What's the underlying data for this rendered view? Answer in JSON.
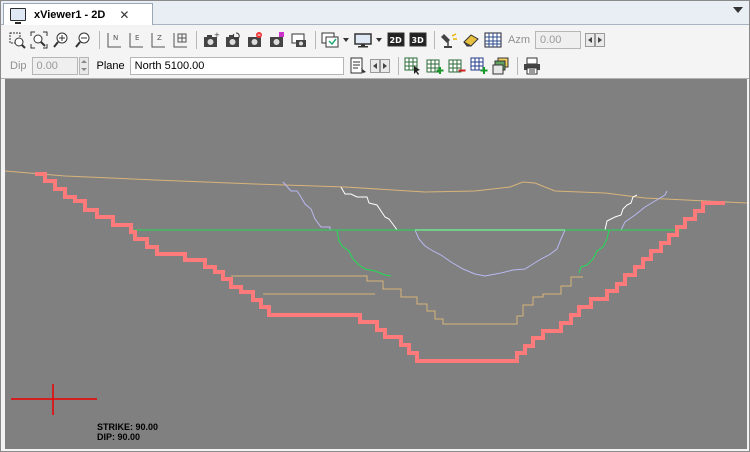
{
  "tab": {
    "title": "xViewer1 - 2D",
    "close_glyph": "✕"
  },
  "toolbar": {
    "row1": {
      "view_2d_label": "2D",
      "view_3d_label": "3D",
      "azimuth_label": "Azm",
      "azimuth_value": "0.00",
      "axis_icons": [
        "N",
        "E",
        "Z"
      ]
    },
    "row2": {
      "dip_label": "Dip",
      "dip_value": "0.00",
      "plane_label": "Plane",
      "plane_value": "North 5100.00"
    }
  },
  "viewport": {
    "background": "#808080",
    "colors": {
      "topography": "#d8b47a",
      "pit_outline": "#ff7a7a",
      "water_level": "#22dd55",
      "blue_shell": "#b8b8f0",
      "white_line": "#ffffff",
      "crosshair": "#ee0000"
    },
    "readout": {
      "strike": "STRIKE: 90.00",
      "dip": "DIP: 90.00"
    }
  }
}
